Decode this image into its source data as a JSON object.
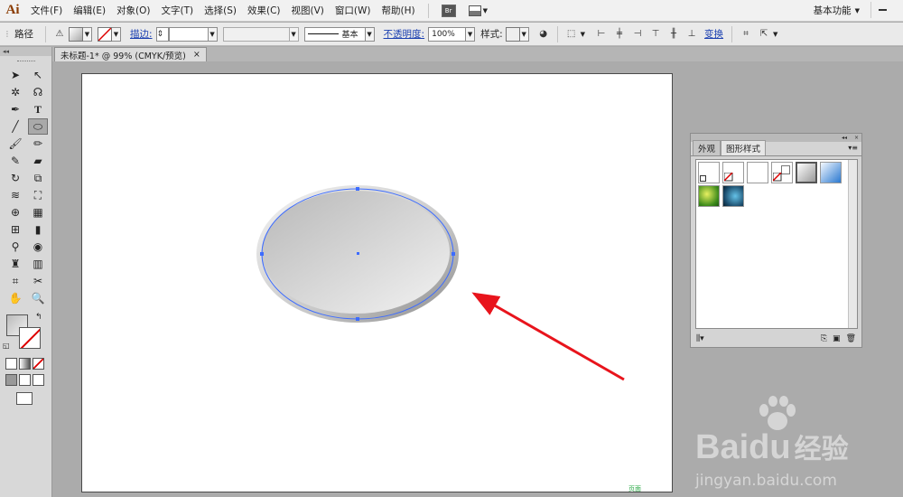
{
  "app": {
    "logo": "Ai",
    "workspace": "基本功能"
  },
  "menu": [
    "文件(F)",
    "编辑(E)",
    "对象(O)",
    "文字(T)",
    "选择(S)",
    "效果(C)",
    "视图(V)",
    "窗口(W)",
    "帮助(H)"
  ],
  "bridge_label": "Br",
  "control": {
    "selection_type": "路径",
    "stroke_label": "描边:",
    "stroke_style": "基本",
    "opacity_label": "不透明度:",
    "opacity_value": "100%",
    "style_label": "样式:",
    "transform_label": "变换"
  },
  "document_tab": {
    "title": "未标题-1* @ 99% (CMYK/预览)",
    "close": "×"
  },
  "panel": {
    "tabs": [
      "外观",
      "图形样式"
    ],
    "active_tab": "图形样式"
  },
  "canvas_status": "页面",
  "watermark": {
    "brand": "Bai",
    "brand2": "du",
    "brand_cn": "经验",
    "url": "jingyan.baidu.com"
  },
  "colors": {
    "annotation_arrow": "#e8141c",
    "path_selection": "#3d6cff",
    "artboard": "#ffffff"
  }
}
